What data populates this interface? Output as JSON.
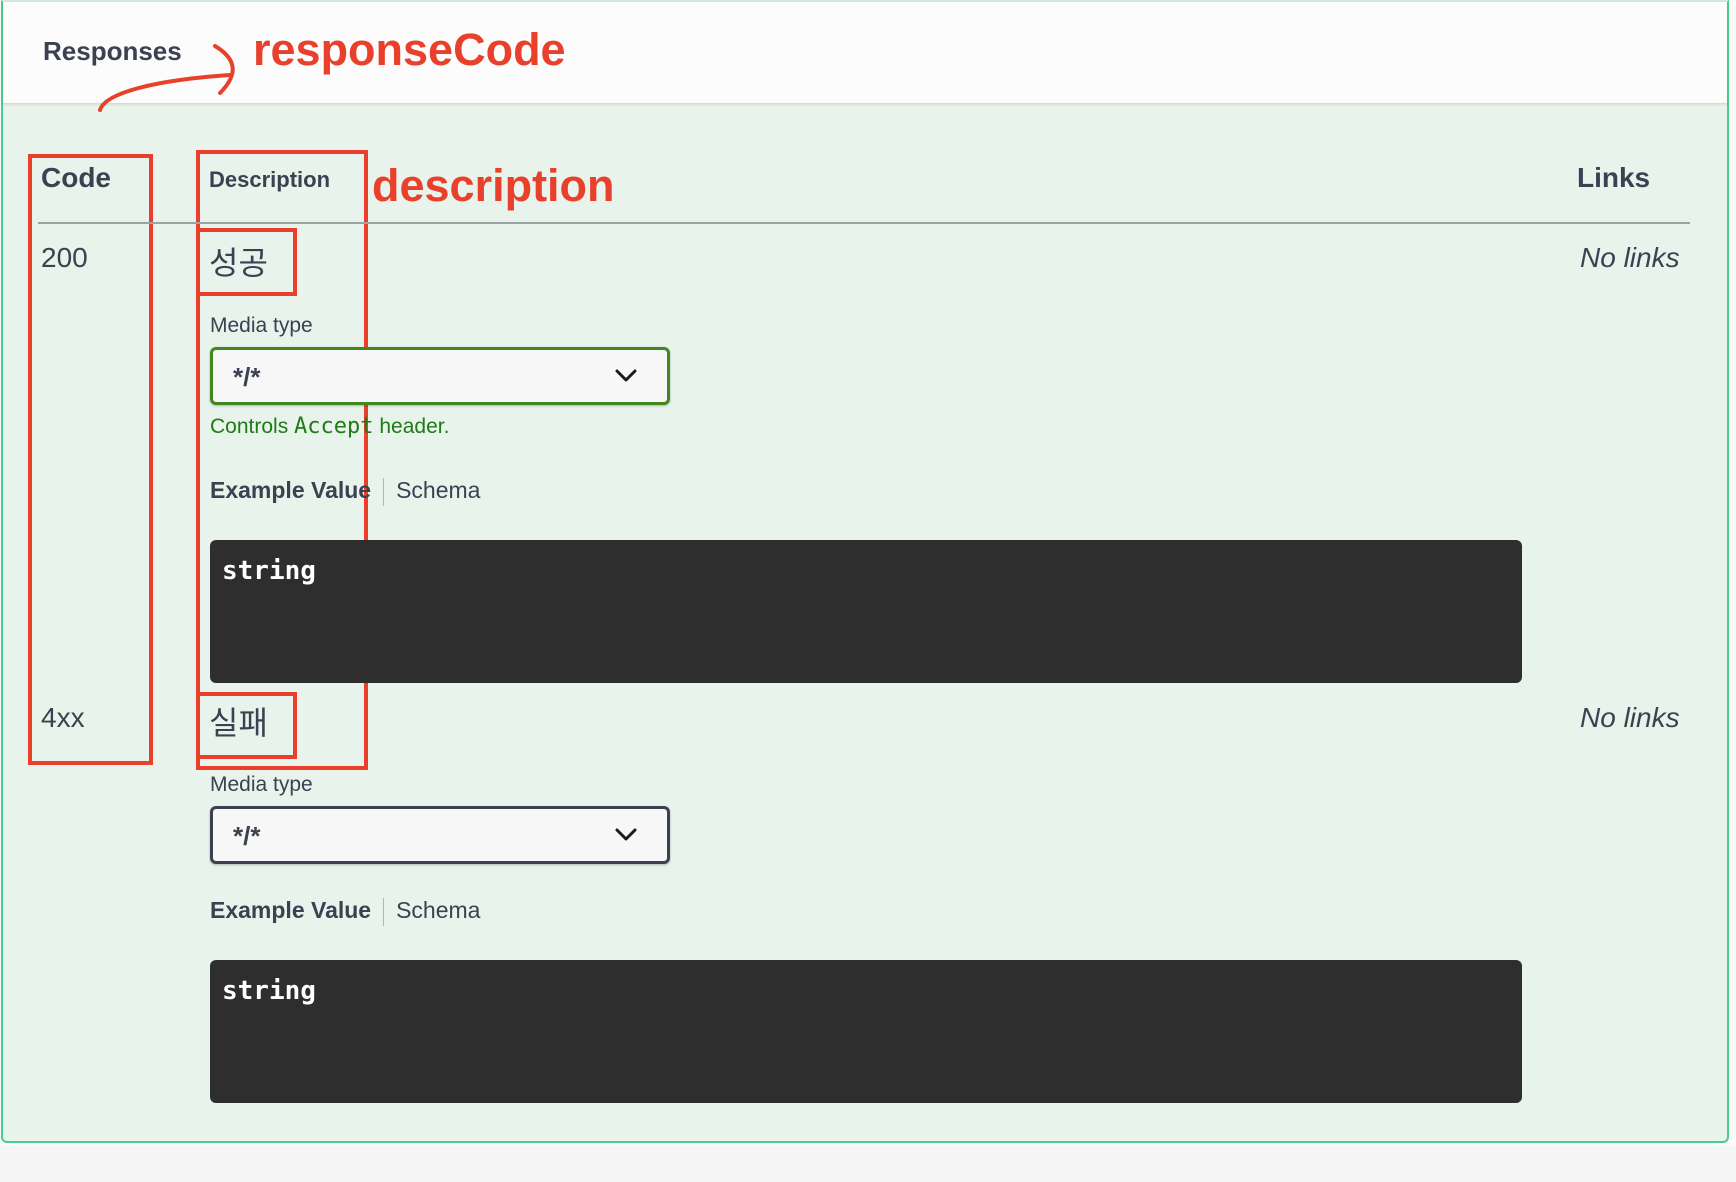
{
  "header": {
    "title": "Responses"
  },
  "annotations": {
    "response_code": "responseCode",
    "description": "description"
  },
  "table": {
    "columns": {
      "code": "Code",
      "description": "Description",
      "links": "Links"
    },
    "rows": [
      {
        "code": "200",
        "description": "성공",
        "media_type_label": "Media type",
        "media_type_value": "*/*",
        "controls_note_prefix": "Controls ",
        "controls_note_code": "Accept",
        "controls_note_suffix": " header.",
        "tab_example": "Example Value",
        "tab_schema": "Schema",
        "example": "string",
        "links": "No links"
      },
      {
        "code": "4xx",
        "description": "실패",
        "media_type_label": "Media type",
        "media_type_value": "*/*",
        "tab_example": "Example Value",
        "tab_schema": "Schema",
        "example": "string",
        "links": "No links"
      }
    ]
  },
  "colors": {
    "annotation": "#e8402a",
    "panel_bg": "#e8f3ec",
    "accent_green": "#49cc90",
    "select_border_active": "#41871f"
  },
  "icons": {
    "arrow": "curved-arrow-icon",
    "chevron": "chevron-down-icon"
  }
}
